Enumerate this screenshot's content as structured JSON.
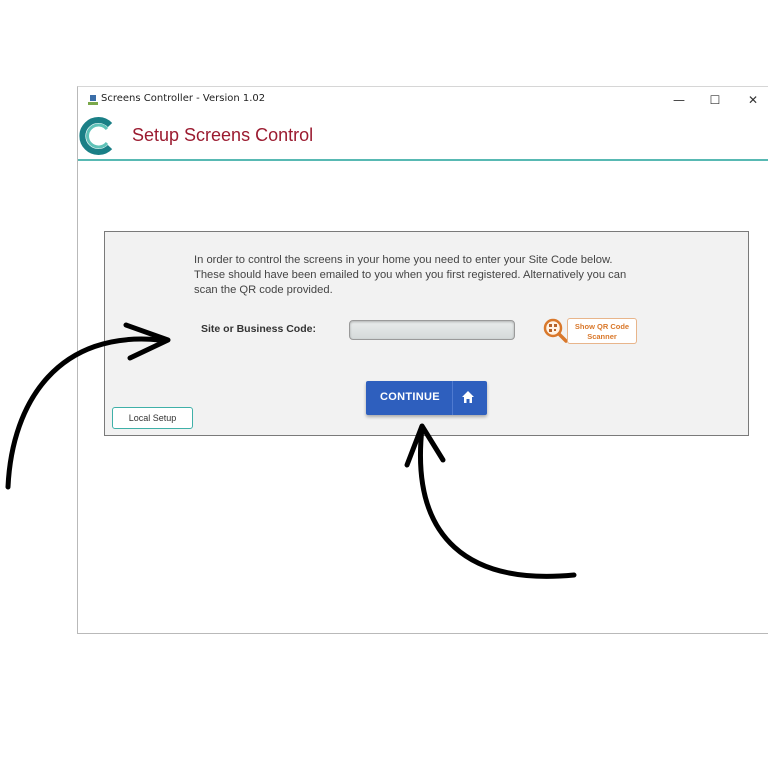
{
  "window": {
    "title": "Screens Controller - Version 1.02",
    "controls": {
      "minimize": "—",
      "maximize": "☐",
      "close": "✕"
    }
  },
  "header": {
    "title": "Setup Screens Control",
    "logo_icon": "c-logo-icon"
  },
  "panel": {
    "instructions": [
      "In order to control the screens in your home you need to enter your Site Code below.",
      "These should have been emailed to you when you first registered. Alternatively you can",
      "scan the QR code provided."
    ],
    "code_label": "Site or Business Code:",
    "code_value": "",
    "qr_icon": "qr-magnifier-icon",
    "qr_button_label": "Show QR Code Scanner",
    "continue_label": "CONTINUE",
    "continue_icon": "home-icon",
    "local_setup_label": "Local Setup"
  },
  "colors": {
    "title_red": "#9b1b30",
    "teal": "#58b9b3",
    "continue_blue": "#2e5fbe",
    "qr_orange": "#d9782b"
  }
}
